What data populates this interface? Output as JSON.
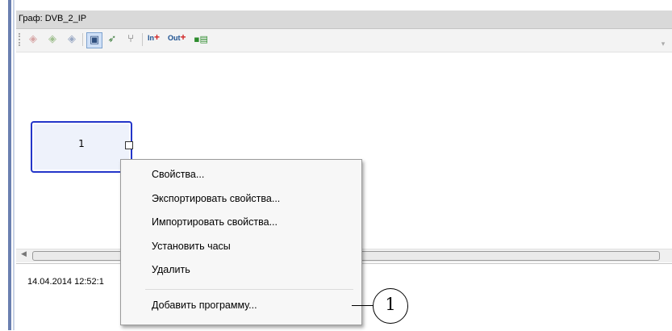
{
  "window": {
    "title": "Граф: DVB_2_IP"
  },
  "toolbar": {
    "icons": [
      "node-add-icon",
      "node-edit-icon",
      "node-copy-icon",
      "select-mode-icon",
      "connect-icon",
      "tree-icon",
      "input-add-icon",
      "output-add-icon",
      "table-icon"
    ],
    "in_label": "In",
    "out_label": "Out"
  },
  "graph": {
    "node_label": "1"
  },
  "log": {
    "line": "14.04.2014 12:52:1"
  },
  "context_menu": {
    "items": [
      "Свойства...",
      "Экспортировать свойства...",
      "Импортировать свойства...",
      "Установить часы",
      "Удалить",
      "Добавить программу..."
    ]
  },
  "callout": {
    "number": "1"
  },
  "colors": {
    "node_border": "#2436c9",
    "node_fill": "#eef2fb",
    "left_stripe": "#6a7fb0"
  }
}
